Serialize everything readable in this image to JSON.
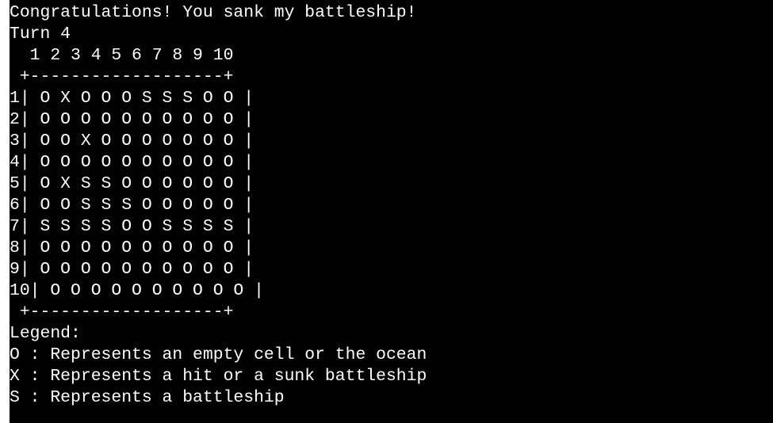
{
  "terminal": {
    "message": "Congratulations! You sank my battleship!",
    "turn": "Turn 4",
    "column_header": "  1 2 3 4 5 6 7 8 9 10",
    "border_top": " +-------------------+",
    "rows": [
      "1| O X O O O S S S O O |",
      "2| O O O O O O O O O O |",
      "3| O O X O O O O O O O |",
      "4| O O O O O O O O O O |",
      "5| O X S S O O O O O O |",
      "6| O O S S S O O O O O |",
      "7| S S S S O O S S S S |",
      "8| O O O O O O O O O O |",
      "9| O O O O O O O O O O |",
      "10| O O O O O O O O O O |"
    ],
    "border_bottom": " +-------------------+",
    "legend_title": "Legend:",
    "legend_items": [
      "O : Represents an empty cell or the ocean",
      "X : Represents a hit or a sunk battleship",
      "S : Represents a battleship"
    ]
  }
}
